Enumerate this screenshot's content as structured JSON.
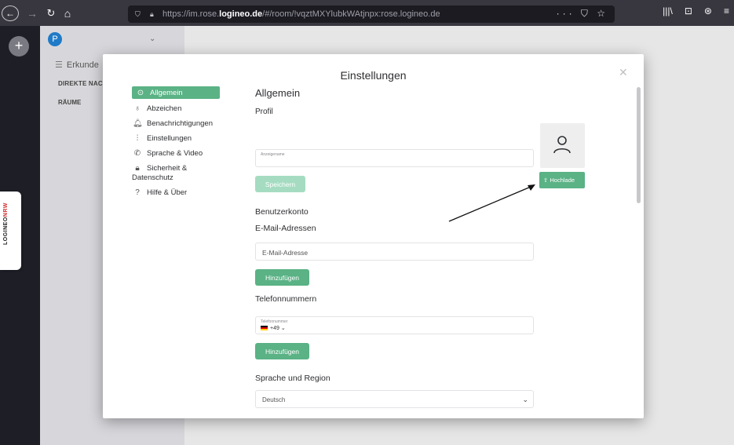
{
  "browser": {
    "url_prefix": "https://im.rose.",
    "url_host": "logineo.de",
    "url_path": "/#/room/!vqztMXYlubkWAtjnpx:rose.logineo.de",
    "url_actions": "··· ⛉ ☆",
    "toolbar_right": [
      "|||\\",
      "⊡",
      "⊛",
      "≡"
    ]
  },
  "app": {
    "avatar_letter": "P",
    "explore_label": "Erkunde",
    "direct_section": "DIREKTE NACH",
    "rooms_section": "RÄUME",
    "side_tab": {
      "brand": "LOGINEO",
      "suffix": "NRW"
    }
  },
  "dialog": {
    "title": "Einstellungen",
    "nav": [
      {
        "label": "Allgemein",
        "icon": "settings-icon"
      },
      {
        "label": "Abzeichen",
        "icon": "badge-icon"
      },
      {
        "label": "Benachrichtigungen",
        "icon": "bell-icon"
      },
      {
        "label": "Einstellungen",
        "icon": "sliders-icon"
      },
      {
        "label": "Sprache & Video",
        "icon": "phone-icon"
      },
      {
        "label": "Sicherheit &",
        "label2": "Datenschutz",
        "icon": "lock-icon"
      },
      {
        "label": "Hilfe & Über",
        "icon": "help-icon"
      }
    ],
    "content": {
      "heading": "Allgemein",
      "profile_heading": "Profil",
      "display_name_label": "Anzeigename",
      "save_button": "Speichern",
      "upload_button": "⇧ Hochlade",
      "account_heading": "Benutzerkonto",
      "email_heading": "E-Mail-Adressen",
      "email_placeholder": "E-Mail-Adresse",
      "add_email_button": "Hinzufügen",
      "phone_heading": "Telefonnummern",
      "phone_label": "Telefonnummer",
      "phone_prefix": "+49",
      "add_phone_button": "Hinzufügen",
      "region_heading": "Sprache und Region",
      "language_value": "Deutsch"
    }
  },
  "colors": {
    "accent": "#5ab285",
    "accent_disabled": "#a5dcc1",
    "rail": "#1e1e26"
  }
}
